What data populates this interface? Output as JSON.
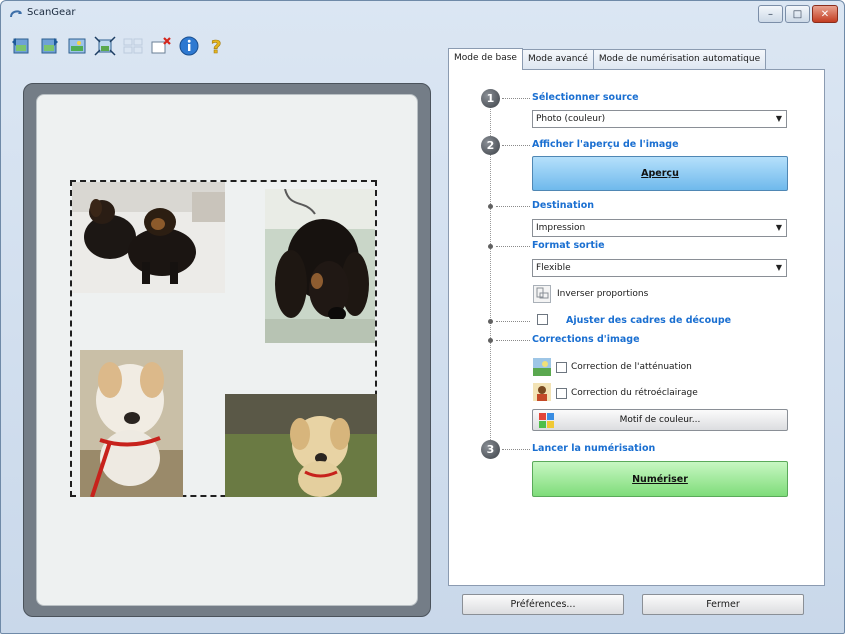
{
  "window": {
    "title": "ScanGear",
    "minimize_glyph": "–",
    "maximize_glyph": "□",
    "close_glyph": "✕"
  },
  "toolbar": {
    "tools": [
      {
        "name": "rotate-left-icon",
        "enabled": true
      },
      {
        "name": "rotate-right-icon",
        "enabled": true
      },
      {
        "name": "auto-crop-icon",
        "enabled": true
      },
      {
        "name": "select-all-frames-icon",
        "enabled": true
      },
      {
        "name": "multi-crop-icon",
        "enabled": false
      },
      {
        "name": "remove-crop-icon",
        "enabled": true
      },
      {
        "name": "info-icon",
        "enabled": true
      },
      {
        "name": "help-icon",
        "enabled": true
      }
    ]
  },
  "tabs": [
    {
      "label": "Mode de base",
      "active": true
    },
    {
      "label": "Mode avancé",
      "active": false
    },
    {
      "label": "Mode de numérisation automatique",
      "active": false
    }
  ],
  "steps": {
    "step1": {
      "number": "1",
      "heading": "Sélectionner source",
      "select_value": "Photo (couleur)"
    },
    "step2": {
      "number": "2",
      "heading": "Afficher l'aperçu de l'image",
      "button": "Aperçu"
    },
    "destination": {
      "heading": "Destination",
      "select_value": "Impression"
    },
    "format": {
      "heading": "Format sortie",
      "select_value": "Flexible",
      "invert_label": "Inverser proportions"
    },
    "crop": {
      "heading": "Ajuster des cadres de découpe",
      "checked": false
    },
    "corrections": {
      "heading": "Corrections d'image",
      "fading_label": "Correction de l'atténuation",
      "fading_checked": false,
      "backlight_label": "Correction du rétroéclairage",
      "backlight_checked": false,
      "color_pattern_button": "Motif de couleur..."
    },
    "step3": {
      "number": "3",
      "heading": "Lancer la numérisation",
      "button": "Numériser"
    }
  },
  "footer": {
    "preferences_button": "Préférences...",
    "close_button": "Fermer"
  },
  "colors": {
    "heading_blue": "#1a6fd1",
    "preview_button": "#6fb9ec",
    "scan_button": "#7fdc7a"
  }
}
